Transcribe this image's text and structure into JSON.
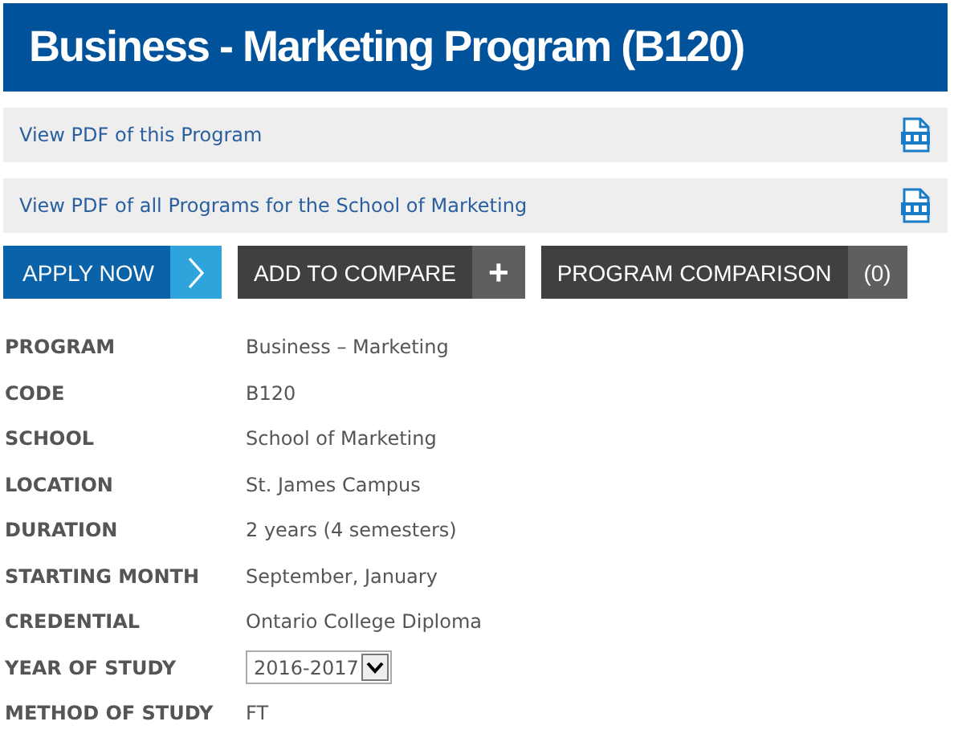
{
  "title": "Business - Marketing Program (B120)",
  "pdf_links": [
    {
      "label": "View PDF of this Program"
    },
    {
      "label": "View PDF of all Programs for the School of Marketing"
    }
  ],
  "buttons": [
    {
      "kind": "apply",
      "label": "APPLY NOW"
    },
    {
      "kind": "add",
      "label": "ADD TO COMPARE",
      "side": "+"
    },
    {
      "kind": "count",
      "label": "PROGRAM COMPARISON",
      "side": "(0)"
    }
  ],
  "details": [
    {
      "kind": "text",
      "label": "PROGRAM",
      "value": "Business – Marketing"
    },
    {
      "kind": "text",
      "label": "CODE",
      "value": "B120"
    },
    {
      "kind": "text",
      "label": "SCHOOL",
      "value": "School of Marketing"
    },
    {
      "kind": "text",
      "label": "LOCATION",
      "value": "St. James Campus"
    },
    {
      "kind": "text",
      "label": "DURATION",
      "value": "2 years (4 semesters)"
    },
    {
      "kind": "text",
      "label": "STARTING MONTH",
      "value": "September, January"
    },
    {
      "kind": "text",
      "label": "CREDENTIAL",
      "value": "Ontario College Diploma"
    },
    {
      "kind": "select",
      "label": "YEAR OF STUDY",
      "value": "2016-2017"
    },
    {
      "kind": "text",
      "label": "METHOD OF STUDY",
      "value": "FT"
    }
  ]
}
